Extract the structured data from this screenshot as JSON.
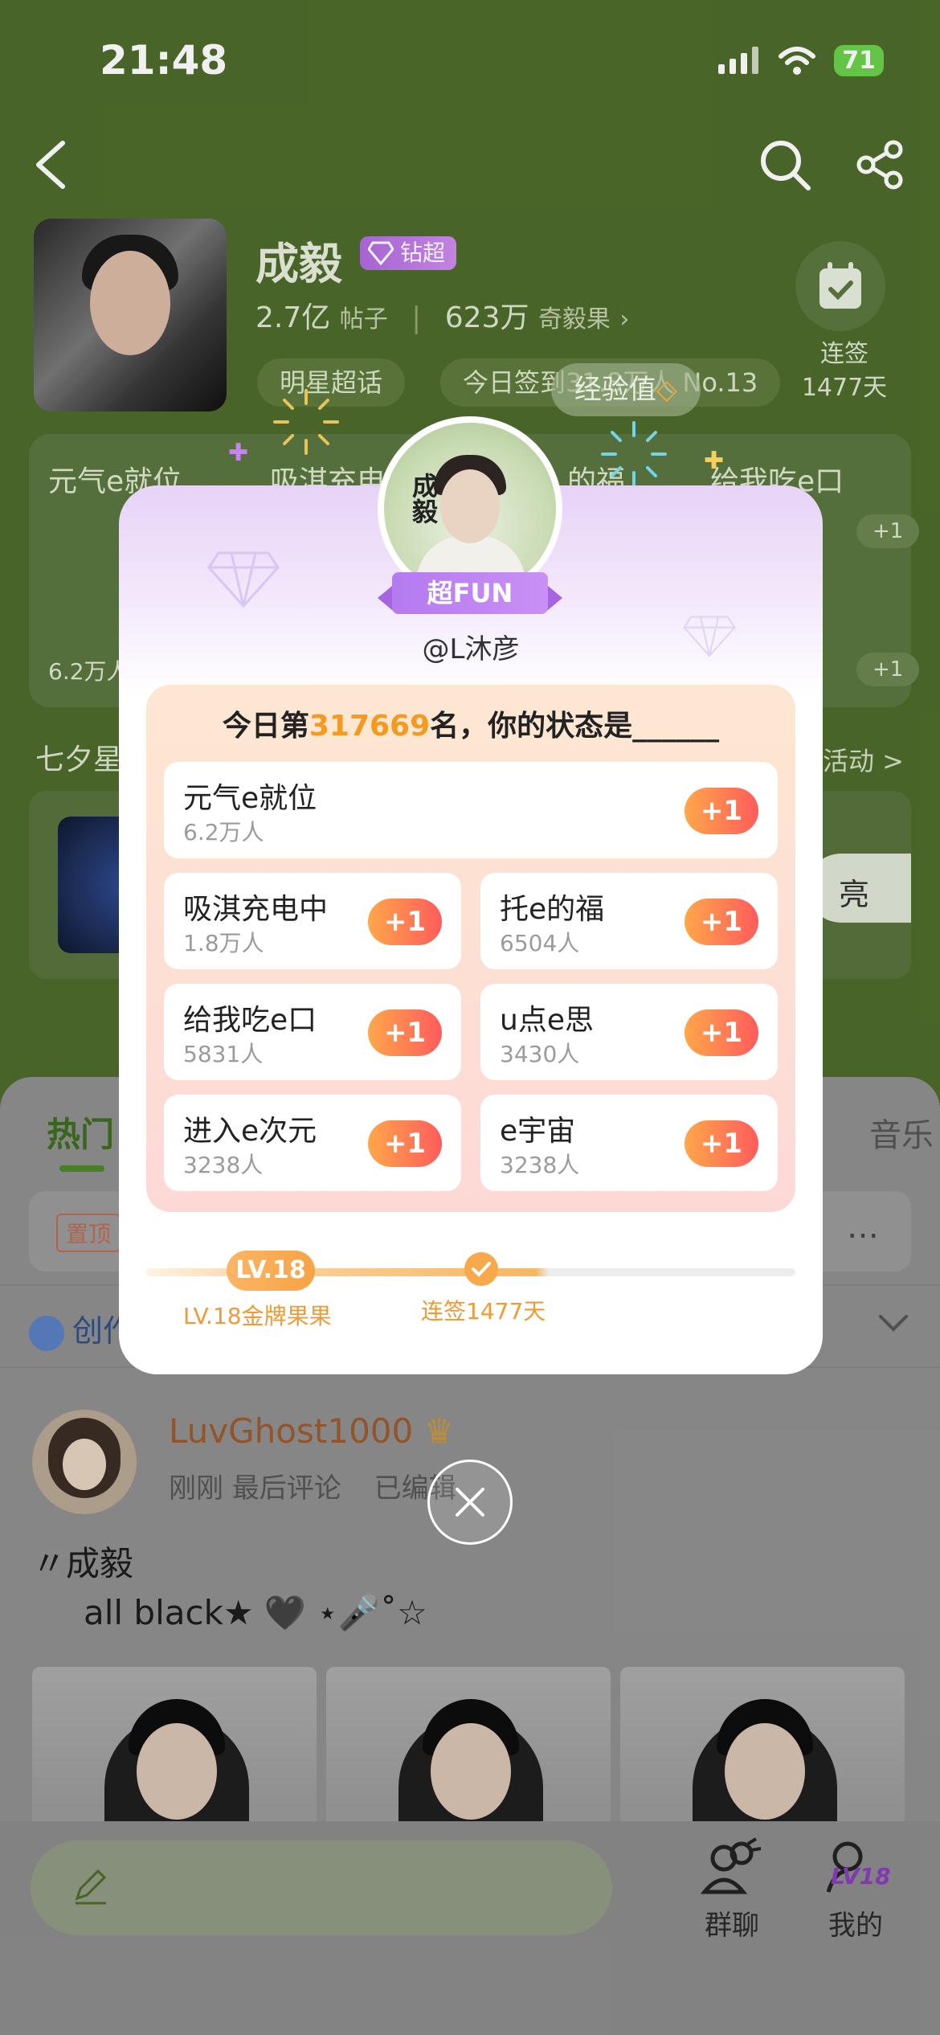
{
  "status": {
    "time": "21:48",
    "battery": "71"
  },
  "header": {
    "celebrity_name": "成毅",
    "badge": "钻超",
    "posts_count": "2.7亿",
    "posts_unit": "帖子",
    "fans_count": "623万",
    "fans_unit": "奇毅果",
    "checkin_label": "连签",
    "checkin_days": "1477天",
    "pill_star": "明星超话",
    "pill_today": "今日签到31.8万人 No.13"
  },
  "background": {
    "card1": "元气e就位",
    "card2": "吸淇充电",
    "card2b": "的福",
    "card3": "给我吃e口",
    "plus": "+1",
    "card_count": "6.2万人",
    "qixi_label": "七夕星",
    "event_more": "活动 >",
    "event_btn": "亮",
    "tab_hot": "热门",
    "tab_music": "音乐",
    "pinned_tag": "置顶",
    "pinned_ellipsis": "…",
    "create_label": "创作"
  },
  "post": {
    "author": "LuvGhost1000",
    "meta_time": "刚刚",
    "meta_last": "最后评论",
    "meta_edit": "已编辑",
    "title": "〃成毅",
    "body": "all black★ 🖤 ⋆🎤˚☆"
  },
  "bottom_bar": {
    "group_chat": "群聊",
    "mine": "我的",
    "lv": "LV18"
  },
  "modal": {
    "exp_pill": "经验值",
    "user_badge": "超FUN",
    "username": "@L沐彦",
    "rank_prefix": "今日第",
    "rank_number": "317669",
    "rank_suffix": "名，你的状态是______",
    "options": [
      {
        "name": "元气e就位",
        "count": "6.2万人",
        "plus": "+1"
      },
      {
        "name": "吸淇充电中",
        "count": "1.8万人",
        "plus": "+1"
      },
      {
        "name": "托e的福",
        "count": "6504人",
        "plus": "+1"
      },
      {
        "name": "给我吃e口",
        "count": "5831人",
        "plus": "+1"
      },
      {
        "name": "u点e思",
        "count": "3430人",
        "plus": "+1"
      },
      {
        "name": "进入e次元",
        "count": "3238人",
        "plus": "+1"
      },
      {
        "name": "e宇宙",
        "count": "3238人",
        "plus": "+1"
      }
    ],
    "level_badge": "LV.18",
    "level_caption": "LV.18金牌果果",
    "streak_caption": "连签1477天",
    "calligraphy": "成毅"
  },
  "colors": {
    "accent_orange": "#f59a1f",
    "super_purple": "#b47af0",
    "theme_green": "#4e6b2b"
  }
}
